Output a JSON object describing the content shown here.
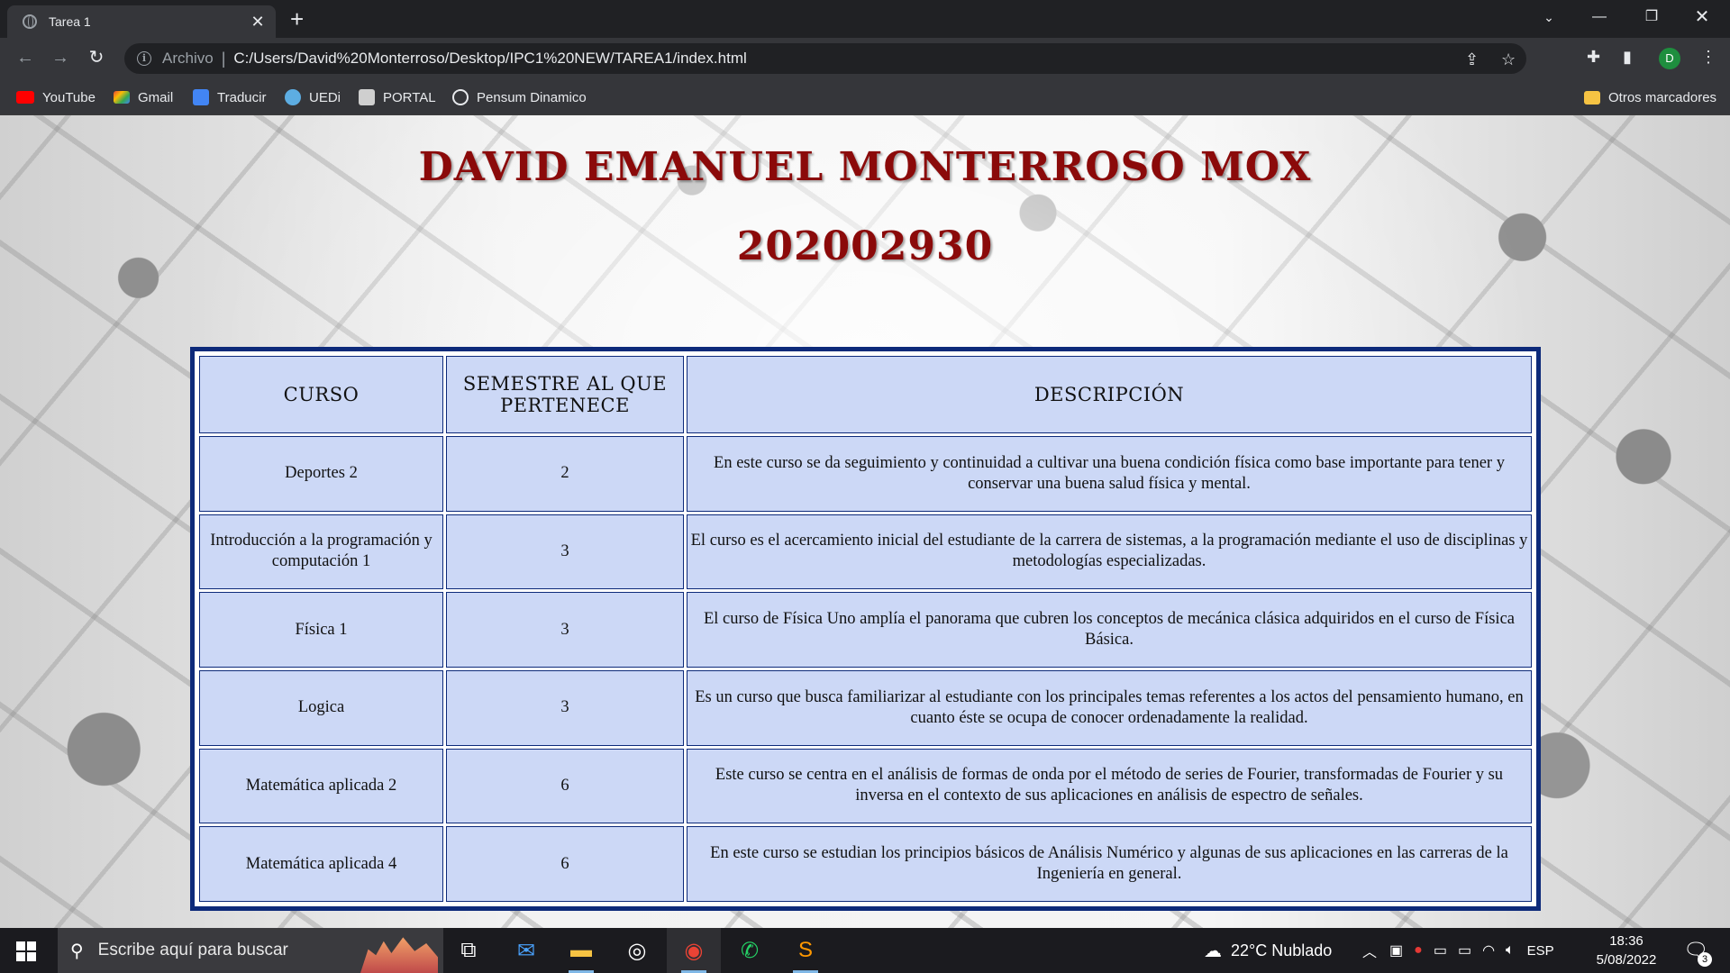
{
  "browser": {
    "tab": {
      "title": "Tarea 1"
    },
    "address": {
      "scheme_label": "Archivo",
      "url": "C:/Users/David%20Monterroso/Desktop/IPC1%20NEW/TAREA1/index.html"
    },
    "profile_initial": "D",
    "bookmarks": [
      {
        "label": "YouTube",
        "icon": "youtube-icon",
        "color": "#ff0000"
      },
      {
        "label": "Gmail",
        "icon": "gmail-icon",
        "color": "#ea4335"
      },
      {
        "label": "Traducir",
        "icon": "translate-icon",
        "color": "#4285f4"
      },
      {
        "label": "UEDi",
        "icon": "uedi-icon",
        "color": "#5dade2"
      },
      {
        "label": "PORTAL",
        "icon": "portal-icon",
        "color": "#cfcfcf"
      },
      {
        "label": "Pensum Dinamico",
        "icon": "pensum-icon",
        "color": "#e8eaed"
      }
    ],
    "other_bookmarks": "Otros marcadores"
  },
  "page": {
    "name": "DAVID EMANUEL MONTERROSO MOX",
    "id": "202002930",
    "table": {
      "headers": [
        "CURSO",
        "SEMESTRE AL QUE PERTENECE",
        "DESCRIPCIÓN"
      ],
      "rows": [
        {
          "curso": "Deportes 2",
          "semestre": "2",
          "descripcion": "En este curso se da seguimiento y continuidad a cultivar una buena condición física como base importante para tener y conservar una buena salud física y mental."
        },
        {
          "curso": "Introducción a la programación y computación 1",
          "semestre": "3",
          "descripcion": "El curso es el acercamiento inicial del estudiante de la carrera de sistemas, a la programación mediante el uso de disciplinas y metodologías especializadas."
        },
        {
          "curso": "Física 1",
          "semestre": "3",
          "descripcion": "El curso de Física Uno amplía el panorama que cubren los conceptos de mecánica clásica adquiridos en el curso de Física Básica."
        },
        {
          "curso": "Logica",
          "semestre": "3",
          "descripcion": "Es un curso que busca familiarizar al estudiante con los principales temas referentes a los actos del pensamiento humano, en cuanto éste se ocupa de conocer ordenadamente la realidad."
        },
        {
          "curso": "Matemática aplicada 2",
          "semestre": "6",
          "descripcion": "Este curso se centra en el análisis de formas de onda por el método de series de Fourier, transformadas de Fourier y su inversa en el contexto de sus aplicaciones en análisis de espectro de señales."
        },
        {
          "curso": "Matemática aplicada 4",
          "semestre": "6",
          "descripcion": "En este curso se estudian los principios básicos de Análisis Numérico y algunas de sus aplicaciones en las carreras de la Ingeniería en general."
        }
      ]
    }
  },
  "taskbar": {
    "search_placeholder": "Escribe aquí para buscar",
    "weather": "22°C  Nublado",
    "language": "ESP",
    "time": "18:36",
    "date": "5/08/2022",
    "notification_count": "3"
  },
  "colors": {
    "title_red": "#8b0a0a",
    "table_border": "#0d2a7a",
    "cell_bg": "#ccd8f6"
  }
}
